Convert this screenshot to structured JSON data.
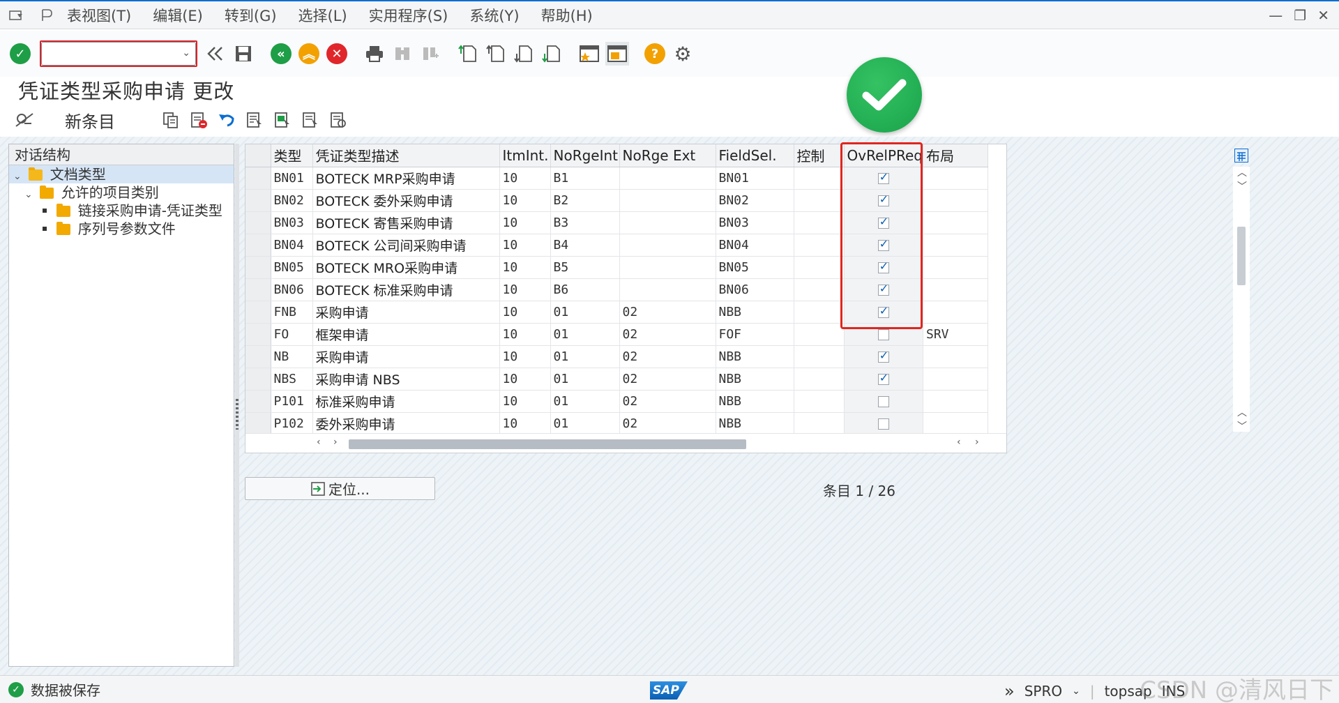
{
  "menu": {
    "items": [
      "表视图(T)",
      "编辑(E)",
      "转到(G)",
      "选择(L)",
      "实用程序(S)",
      "系统(Y)",
      "帮助(H)"
    ]
  },
  "toolbar": {
    "command_value": ""
  },
  "title": "凭证类型采购申请 更改",
  "app_toolbar": {
    "new_entry": "新条目"
  },
  "dialog_structure": {
    "header": "对话结构",
    "nodes": [
      {
        "label": "文档类型"
      },
      {
        "label": "允许的项目类别"
      },
      {
        "label": "链接采购申请-凭证类型"
      },
      {
        "label": "序列号参数文件"
      }
    ]
  },
  "table": {
    "columns": [
      "类型",
      "凭证类型描述",
      "ItmInt.",
      "NoRgeInt",
      "NoRge Ext",
      "FieldSel.",
      "控制",
      "OvRelPReq",
      "布局"
    ],
    "rows": [
      {
        "type": "BN01",
        "desc": "BOTECK MRP采购申请",
        "itm": "10",
        "nri": "B1",
        "nre": "",
        "fs": "BN01",
        "ctl": "",
        "ov": true,
        "layout": ""
      },
      {
        "type": "BN02",
        "desc": "BOTECK 委外采购申请",
        "itm": "10",
        "nri": "B2",
        "nre": "",
        "fs": "BN02",
        "ctl": "",
        "ov": true,
        "layout": ""
      },
      {
        "type": "BN03",
        "desc": "BOTECK 寄售采购申请",
        "itm": "10",
        "nri": "B3",
        "nre": "",
        "fs": "BN03",
        "ctl": "",
        "ov": true,
        "layout": ""
      },
      {
        "type": "BN04",
        "desc": "BOTECK 公司间采购申请",
        "itm": "10",
        "nri": "B4",
        "nre": "",
        "fs": "BN04",
        "ctl": "",
        "ov": true,
        "layout": ""
      },
      {
        "type": "BN05",
        "desc": "BOTECK MRO采购申请",
        "itm": "10",
        "nri": "B5",
        "nre": "",
        "fs": "BN05",
        "ctl": "",
        "ov": true,
        "layout": ""
      },
      {
        "type": "BN06",
        "desc": "BOTECK 标准采购申请",
        "itm": "10",
        "nri": "B6",
        "nre": "",
        "fs": "BN06",
        "ctl": "",
        "ov": true,
        "layout": ""
      },
      {
        "type": "FNB",
        "desc": "采购申请",
        "itm": "10",
        "nri": "01",
        "nre": "02",
        "fs": "NBB",
        "ctl": "",
        "ov": true,
        "layout": ""
      },
      {
        "type": "FO",
        "desc": "框架申请",
        "itm": "10",
        "nri": "01",
        "nre": "02",
        "fs": "FOF",
        "ctl": "",
        "ov": false,
        "layout": "SRV"
      },
      {
        "type": "NB",
        "desc": "采购申请",
        "itm": "10",
        "nri": "01",
        "nre": "02",
        "fs": "NBB",
        "ctl": "",
        "ov": true,
        "layout": ""
      },
      {
        "type": "NBS",
        "desc": "采购申请 NBS",
        "itm": "10",
        "nri": "01",
        "nre": "02",
        "fs": "NBB",
        "ctl": "",
        "ov": true,
        "layout": ""
      },
      {
        "type": "P101",
        "desc": "标准采购申请",
        "itm": "10",
        "nri": "01",
        "nre": "02",
        "fs": "NBB",
        "ctl": "",
        "ov": false,
        "layout": ""
      },
      {
        "type": "P102",
        "desc": "委外采购申请",
        "itm": "10",
        "nri": "01",
        "nre": "02",
        "fs": "NBB",
        "ctl": "",
        "ov": false,
        "layout": ""
      }
    ]
  },
  "position_button": "定位...",
  "entries": {
    "label": "条目",
    "value": "1 / 26"
  },
  "status": {
    "message": "数据被保存",
    "sap_logo": "SAP",
    "transaction": "SPRO",
    "user": "topsap",
    "mode": "INS"
  },
  "watermark": "CSDN @清风日下",
  "colors": {
    "highlight": "#e0261f",
    "ok_green": "#1e9e46",
    "sap_blue": "#0a6ed1"
  }
}
